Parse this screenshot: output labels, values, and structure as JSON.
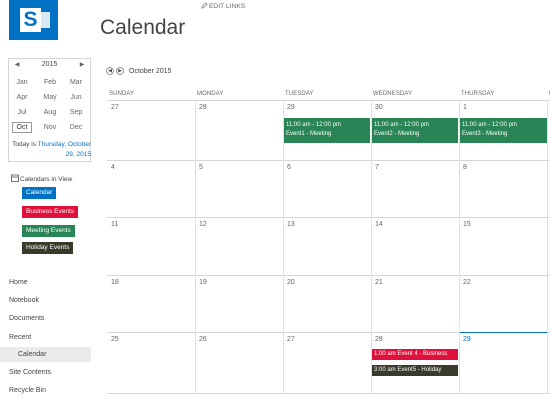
{
  "header": {
    "edit_links": "EDIT LINKS",
    "title": "Calendar"
  },
  "picker": {
    "year": "2015",
    "months": [
      "Jan",
      "Feb",
      "Mar",
      "Apr",
      "May",
      "Jun",
      "Jul",
      "Aug",
      "Sep",
      "Oct",
      "Nov",
      "Dec"
    ],
    "selected_month": "Oct",
    "today_prefix": "Today is ",
    "today_link": "Thursday, October 29, 2015"
  },
  "calendars_in_view": {
    "title": "Calendars in View",
    "items": [
      {
        "label": "Calendar",
        "color": "#0072c6"
      },
      {
        "label": "Business Events",
        "color": "#e0103c"
      },
      {
        "label": "Meeting Events",
        "color": "#2a8556"
      },
      {
        "label": "Holiday Events",
        "color": "#3a3a2c"
      }
    ]
  },
  "nav": {
    "items": [
      "Home",
      "Notebook",
      "Documents",
      "Recent",
      "Calendar",
      "Site Contents",
      "Recycle Bin"
    ]
  },
  "calendar": {
    "month_label": "October 2015",
    "days": [
      "SUNDAY",
      "MONDAY",
      "TUESDAY",
      "WEDNESDAY",
      "THURSDAY",
      "F"
    ],
    "weeks": [
      [
        "27",
        "28",
        "29",
        "30",
        "1"
      ],
      [
        "4",
        "5",
        "6",
        "7",
        "8"
      ],
      [
        "11",
        "12",
        "13",
        "14",
        "15"
      ],
      [
        "18",
        "19",
        "20",
        "21",
        "22"
      ],
      [
        "25",
        "26",
        "27",
        "28",
        "29"
      ]
    ],
    "today_date": "29",
    "events": [
      {
        "time": "11:00 am - 12:00 pm",
        "title": "Event1 - Meeting",
        "color": "#2a8556"
      },
      {
        "time": "11:00 am - 12:00 pm",
        "title": "Event2 - Meeting",
        "color": "#2a8556"
      },
      {
        "time": "11:00 am - 12:00 pm",
        "title": "Event3 - Meeting",
        "color": "#2a8556"
      },
      {
        "time": "1:00 am",
        "title": "Event 4 - Business",
        "color": "#e0103c"
      },
      {
        "time": "3:00 am",
        "title": "Event5 - Holiday",
        "color": "#3a3a2c"
      }
    ]
  }
}
